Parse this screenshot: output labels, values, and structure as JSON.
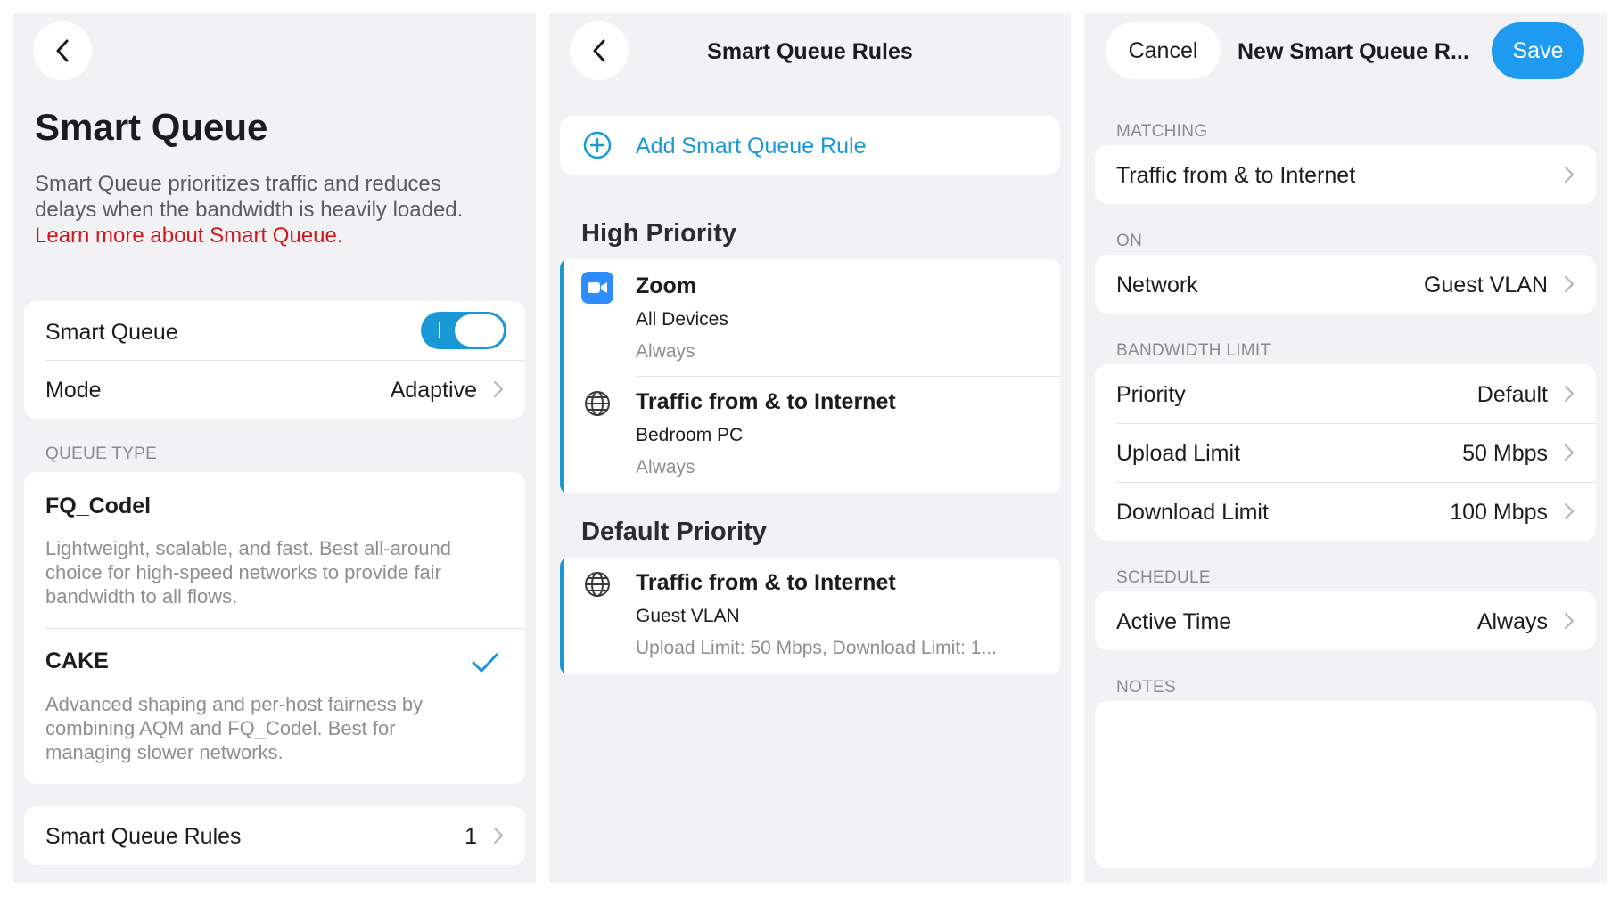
{
  "panel1": {
    "title": "Smart Queue",
    "description_line1": "Smart Queue prioritizes traffic and reduces",
    "description_line2": "delays when the bandwidth is heavily loaded.",
    "learn_more": "Learn more about Smart Queue.",
    "toggle_label": "Smart Queue",
    "toggle_on": true,
    "mode_label": "Mode",
    "mode_value": "Adaptive",
    "queue_type_caption": "QUEUE TYPE",
    "fq_codel": {
      "title": "FQ_Codel",
      "line1": "Lightweight, scalable, and fast. Best all-around",
      "line2": "choice for high-speed networks to provide fair",
      "line3": "bandwidth to all flows."
    },
    "cake": {
      "title": "CAKE",
      "line1": "Advanced shaping and per-host fairness by",
      "line2": "combining AQM and FQ_Codel. Best for",
      "line3": "managing slower networks.",
      "selected": true
    },
    "rules_label": "Smart Queue Rules",
    "rules_count": "1"
  },
  "panel2": {
    "title": "Smart Queue Rules",
    "add_rule": "Add Smart Queue Rule",
    "high_priority": {
      "heading": "High Priority",
      "rules": [
        {
          "icon": "zoom-app-icon",
          "title": "Zoom",
          "subtitle": "All Devices",
          "detail": "Always"
        },
        {
          "icon": "globe-icon",
          "title": "Traffic from & to Internet",
          "subtitle": "Bedroom PC",
          "detail": "Always"
        }
      ]
    },
    "default_priority": {
      "heading": "Default Priority",
      "rules": [
        {
          "icon": "globe-icon",
          "title": "Traffic from & to Internet",
          "subtitle": "Guest VLAN",
          "detail": "Upload Limit: 50 Mbps, Download Limit: 1..."
        }
      ]
    }
  },
  "panel3": {
    "cancel": "Cancel",
    "title": "New Smart Queue R...",
    "save": "Save",
    "matching_caption": "MATCHING",
    "matching_value": "Traffic from & to Internet",
    "on_caption": "ON",
    "network_label": "Network",
    "network_value": "Guest VLAN",
    "bandwidth_caption": "BANDWIDTH LIMIT",
    "priority_label": "Priority",
    "priority_value": "Default",
    "upload_label": "Upload Limit",
    "upload_value": "50 Mbps",
    "download_label": "Download Limit",
    "download_value": "100 Mbps",
    "schedule_caption": "SCHEDULE",
    "active_time_label": "Active Time",
    "active_time_value": "Always",
    "notes_caption": "NOTES"
  },
  "colors": {
    "accent_blue": "#1a98d5",
    "save_blue": "#1e9bf0",
    "link_red": "#d4151b",
    "background": "#f2f2f4"
  }
}
